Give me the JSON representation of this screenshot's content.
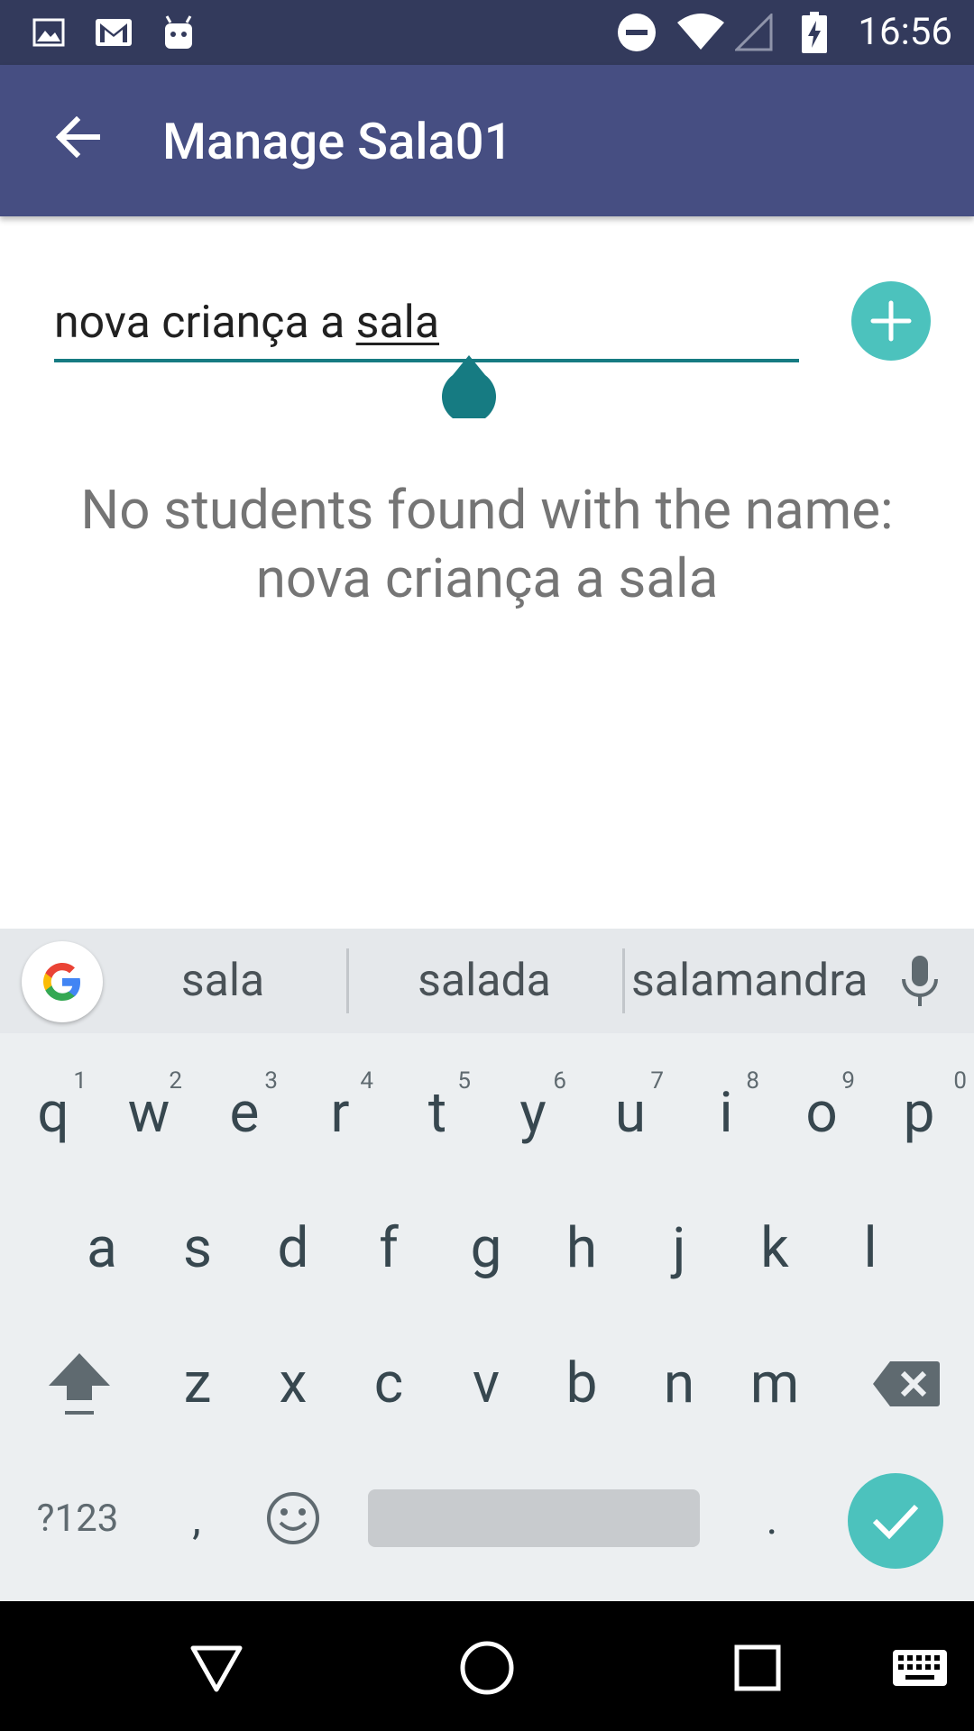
{
  "status_bar": {
    "time": "16:56",
    "left_icons": [
      "image-icon",
      "gmail-icon",
      "android-icon"
    ],
    "right_icons": [
      "do-not-disturb-icon",
      "wifi-icon",
      "signal-icon",
      "battery-charging-icon"
    ]
  },
  "app_bar": {
    "title": "Manage Sala01",
    "back_icon": "arrow-back-icon",
    "color": "#464e82"
  },
  "search": {
    "value_prefix": "nova criança a ",
    "value_composing": "sala",
    "underline_color": "#167b82"
  },
  "add_button": {
    "icon": "plus-icon",
    "color": "#4cc2bd"
  },
  "empty_message": "No students found with the name: nova criança a sala",
  "keyboard": {
    "suggestions": [
      "sala",
      "salada",
      "salamandra"
    ],
    "row1": [
      {
        "key": "q",
        "hint": "1"
      },
      {
        "key": "w",
        "hint": "2"
      },
      {
        "key": "e",
        "hint": "3"
      },
      {
        "key": "r",
        "hint": "4"
      },
      {
        "key": "t",
        "hint": "5"
      },
      {
        "key": "y",
        "hint": "6"
      },
      {
        "key": "u",
        "hint": "7"
      },
      {
        "key": "i",
        "hint": "8"
      },
      {
        "key": "o",
        "hint": "9"
      },
      {
        "key": "p",
        "hint": "0"
      }
    ],
    "row2": [
      "a",
      "s",
      "d",
      "f",
      "g",
      "h",
      "j",
      "k",
      "l"
    ],
    "row3": [
      "z",
      "x",
      "c",
      "v",
      "b",
      "n",
      "m"
    ],
    "symbols_label": "?123",
    "comma": ",",
    "period": ".",
    "enter_color": "#4cc2bd"
  },
  "nav_bar": {
    "icons": [
      "back-triangle-icon",
      "home-circle-icon",
      "recents-square-icon",
      "keyboard-switch-icon"
    ]
  }
}
